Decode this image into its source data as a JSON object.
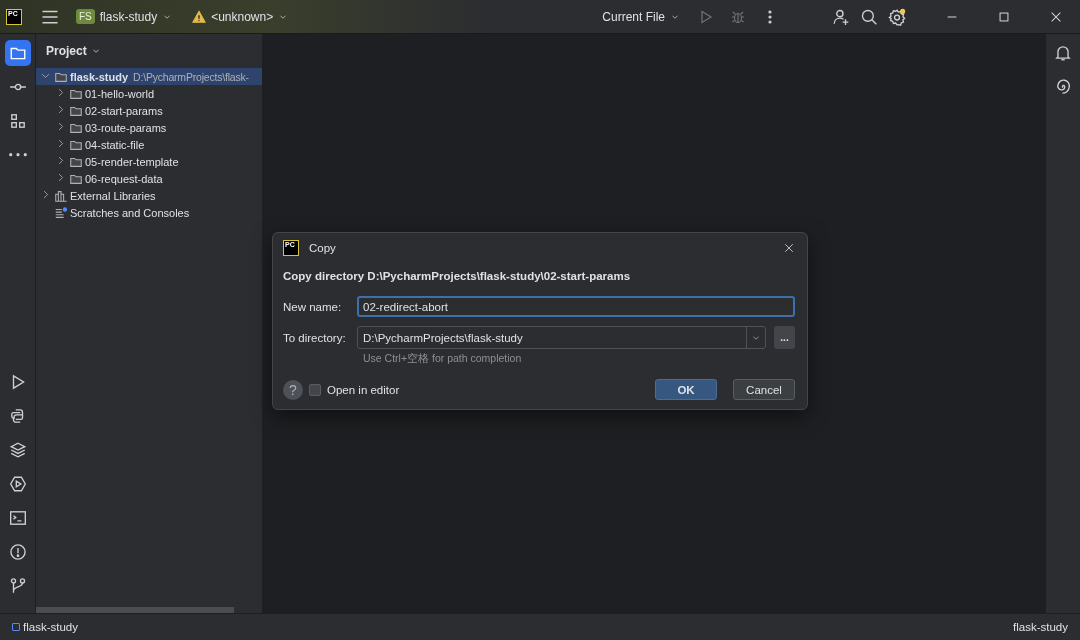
{
  "titlebar": {
    "app_logo": "PC",
    "project_badge": "FS",
    "project": "flask-study",
    "vcs": "<unknown>",
    "run_config": "Current File",
    "run_enabled": false,
    "settings_notice": true
  },
  "left_toolbar": {
    "top": [
      {
        "kind": "project",
        "selected": true
      },
      {
        "kind": "commit",
        "selected": false
      },
      {
        "kind": "structure",
        "selected": false
      },
      {
        "kind": "more",
        "selected": false
      }
    ],
    "bottom": [
      {
        "kind": "run",
        "selected": false
      },
      {
        "kind": "python",
        "selected": false
      },
      {
        "kind": "layers",
        "selected": false
      },
      {
        "kind": "services",
        "selected": false
      },
      {
        "kind": "terminal",
        "selected": false
      },
      {
        "kind": "problems",
        "selected": false
      },
      {
        "kind": "git",
        "selected": false
      }
    ]
  },
  "right_toolbar": [
    {
      "kind": "notifications"
    },
    {
      "kind": "assistant"
    }
  ],
  "project_panel": {
    "title": "Project",
    "tree": [
      {
        "label": "flask-study",
        "path": "D:\\PycharmProjects\\flask-",
        "kind": "folder",
        "expanded": true,
        "selected": true,
        "children": [
          {
            "label": "01-hello-world",
            "kind": "folder",
            "expanded": false,
            "selected": false
          },
          {
            "label": "02-start-params",
            "kind": "folder",
            "expanded": false,
            "selected": false
          },
          {
            "label": "03-route-params",
            "kind": "folder",
            "expanded": false,
            "selected": false
          },
          {
            "label": "04-static-file",
            "kind": "folder",
            "expanded": false,
            "selected": false
          },
          {
            "label": "05-render-template",
            "kind": "folder",
            "expanded": false,
            "selected": false
          },
          {
            "label": "06-request-data",
            "kind": "folder",
            "expanded": false,
            "selected": false
          }
        ]
      },
      {
        "label": "External Libraries",
        "kind": "library",
        "expanded": false,
        "selected": false
      },
      {
        "label": "Scratches and Consoles",
        "kind": "scratches",
        "selected": false
      }
    ]
  },
  "dialog": {
    "logo": "PC",
    "title": "Copy",
    "heading": "Copy directory D:\\PycharmProjects\\flask-study\\02-start-params",
    "fields": [
      {
        "kind": "text",
        "label": "New name:",
        "value": "02-redirect-abort",
        "focused": true
      },
      {
        "kind": "combo",
        "label": "To directory:",
        "value": "D:\\PycharmProjects\\flask-study",
        "focused": false,
        "browse": "...",
        "hint": "Use Ctrl+空格 for path completion"
      }
    ],
    "help": "?",
    "checkbox": {
      "label": "Open in editor",
      "checked": false
    },
    "buttons": [
      {
        "label": "OK",
        "default": true
      },
      {
        "label": "Cancel",
        "default": false
      }
    ]
  },
  "status_bar": {
    "left": "flask-study",
    "right": "flask-study"
  }
}
